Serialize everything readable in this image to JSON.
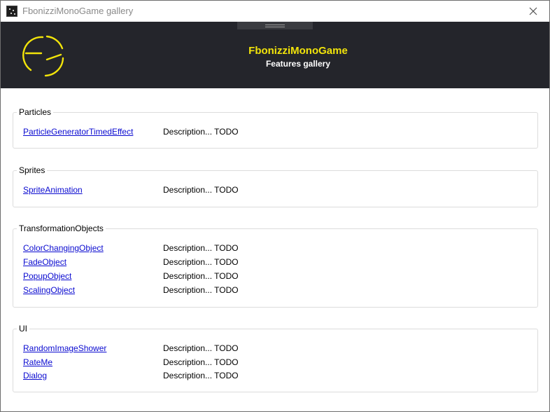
{
  "window": {
    "title": "FbonizziMonoGame gallery"
  },
  "header": {
    "title": "FbonizziMonoGame",
    "subtitle": "Features gallery",
    "accent_color": "#f2e40a",
    "background_color": "#24252b"
  },
  "groups": [
    {
      "title": "Particles",
      "items": [
        {
          "link": "ParticleGeneratorTimedEffect",
          "description": "Description... TODO"
        }
      ]
    },
    {
      "title": "Sprites",
      "items": [
        {
          "link": "SpriteAnimation",
          "description": "Description... TODO"
        }
      ]
    },
    {
      "title": "TransformationObjects",
      "items": [
        {
          "link": "ColorChangingObject",
          "description": "Description... TODO"
        },
        {
          "link": "FadeObject",
          "description": "Description... TODO"
        },
        {
          "link": "PopupObject",
          "description": "Description... TODO"
        },
        {
          "link": "ScalingObject",
          "description": "Description... TODO"
        }
      ]
    },
    {
      "title": "UI",
      "items": [
        {
          "link": "RandomImageShower",
          "description": "Description... TODO"
        },
        {
          "link": "RateMe",
          "description": "Description... TODO"
        },
        {
          "link": "Dialog",
          "description": "Description... TODO"
        }
      ]
    }
  ],
  "icons": {
    "app": "app-icon",
    "close": "close-icon",
    "logo": "fs-logo-icon",
    "grip": "grip-handle-icon"
  },
  "link_color": "#0a0ad0"
}
